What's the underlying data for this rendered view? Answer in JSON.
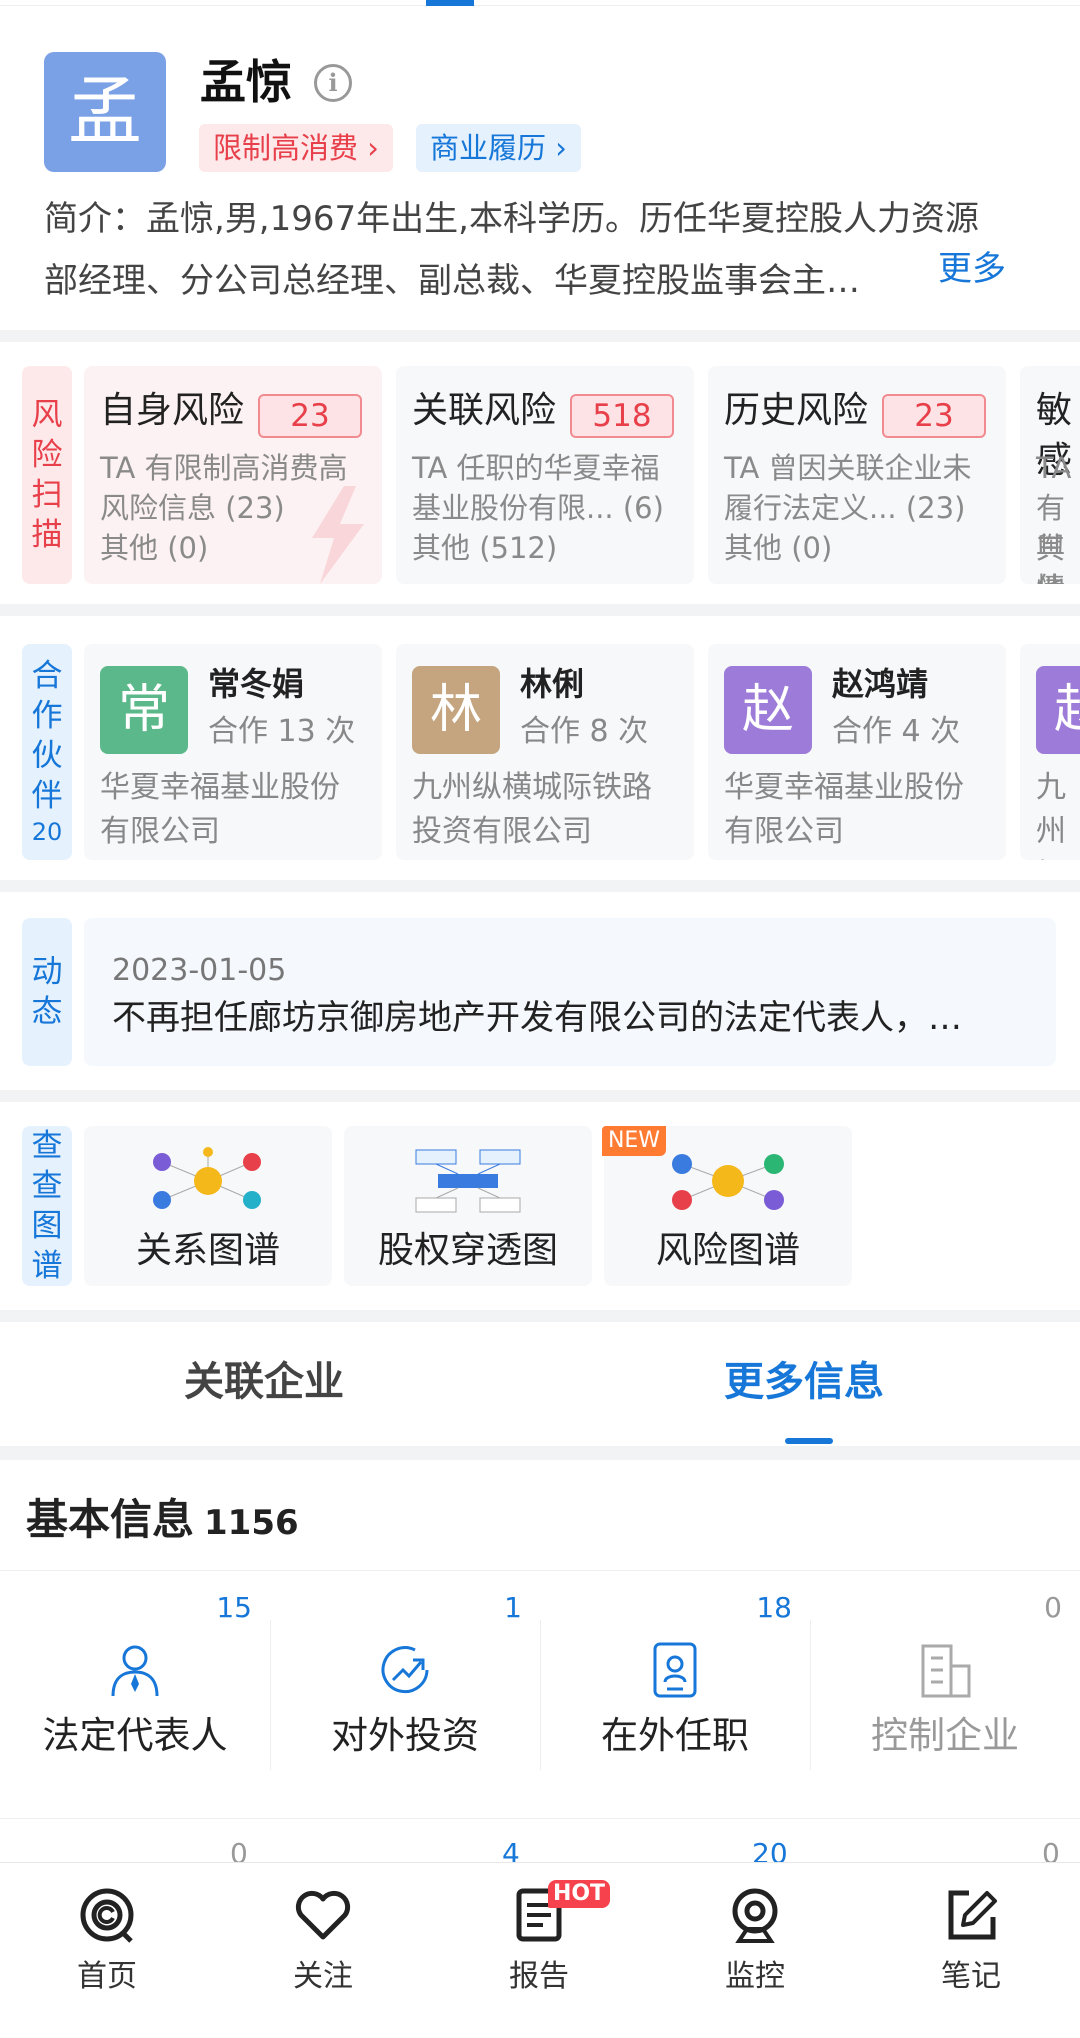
{
  "profile": {
    "avatar_char": "孟",
    "name": "孟惊",
    "info_icon": "info-icon",
    "tags": [
      "限制高消费 ›",
      "商业履历 ›"
    ],
    "intro_line1": "简介：孟惊,男,1967年出生,本科学历。历任华夏控股人力资源",
    "intro_line2": "部经理、分公司总经理、副总裁、华夏控股监事会主…",
    "more": "更多"
  },
  "risk": {
    "label": [
      "风",
      "险",
      "扫",
      "描"
    ],
    "cards": [
      {
        "title": "自身风险",
        "badge": "23",
        "desc1": "TA 有限制高消费高",
        "desc2": "风险信息 (23)",
        "other": "其他 (0)"
      },
      {
        "title": "关联风险",
        "badge": "518",
        "desc1": "TA 任职的华夏幸福",
        "desc2": "基业股份有限... (6)",
        "other": "其他 (512)"
      },
      {
        "title": "历史风险",
        "badge": "23",
        "desc1": "TA 曾因关联企业未",
        "desc2": "履行法定义... (23)",
        "other": "其他 (0)"
      },
      {
        "title": "敏感",
        "desc1": "TA 有",
        "desc2": "舆情",
        "other": "其他"
      }
    ]
  },
  "partners": {
    "label": [
      "合",
      "作",
      "伙",
      "伴"
    ],
    "count": "20",
    "items": [
      {
        "char": "常",
        "name": "常冬娟",
        "times": "合作 13 次",
        "comp1": "华夏幸福基业股份",
        "comp2": "有限公司",
        "color": "#5bb88a"
      },
      {
        "char": "林",
        "name": "林俐",
        "times": "合作 8 次",
        "comp1": "九州纵横城际铁路",
        "comp2": "投资有限公司",
        "color": "#c4a57f"
      },
      {
        "char": "赵",
        "name": "赵鸿靖",
        "times": "合作 4 次",
        "comp1": "华夏幸福基业股份",
        "comp2": "有限公司",
        "color": "#9d7bd8"
      },
      {
        "char": "赵",
        "comp1": "九州",
        "comp2": "投资",
        "color": "#9d7bd8"
      }
    ]
  },
  "dynamic": {
    "label": [
      "动",
      "态"
    ],
    "date": "2023-01-05",
    "text": "不再担任廊坊京御房地产开发有限公司的法定代表人，…"
  },
  "graphs": {
    "label": [
      "查",
      "查",
      "图",
      "谱"
    ],
    "items": [
      {
        "title": "关系图谱"
      },
      {
        "title": "股权穿透图"
      },
      {
        "title": "风险图谱",
        "badge": "NEW"
      }
    ]
  },
  "tabs": [
    {
      "label": "关联企业"
    },
    {
      "label": "更多信息"
    }
  ],
  "basic_info": {
    "title": "基本信息",
    "count": "1156",
    "grid": [
      {
        "label": "法定代表人",
        "count": "15",
        "icon": "person-tie-icon"
      },
      {
        "label": "对外投资",
        "count": "1",
        "icon": "investment-arrow-icon"
      },
      {
        "label": "在外任职",
        "count": "18",
        "icon": "id-badge-icon"
      },
      {
        "label": "控制企业",
        "count": "0",
        "icon": "building-icon"
      }
    ],
    "next_row_counts": [
      "0",
      "4",
      "20",
      "0"
    ]
  },
  "bottom_nav": [
    {
      "label": "首页",
      "icon": "home-logo-icon"
    },
    {
      "label": "关注",
      "icon": "heart-icon"
    },
    {
      "label": "报告",
      "icon": "report-icon",
      "badge": "HOT"
    },
    {
      "label": "监控",
      "icon": "monitor-camera-icon"
    },
    {
      "label": "笔记",
      "icon": "note-edit-icon"
    }
  ]
}
